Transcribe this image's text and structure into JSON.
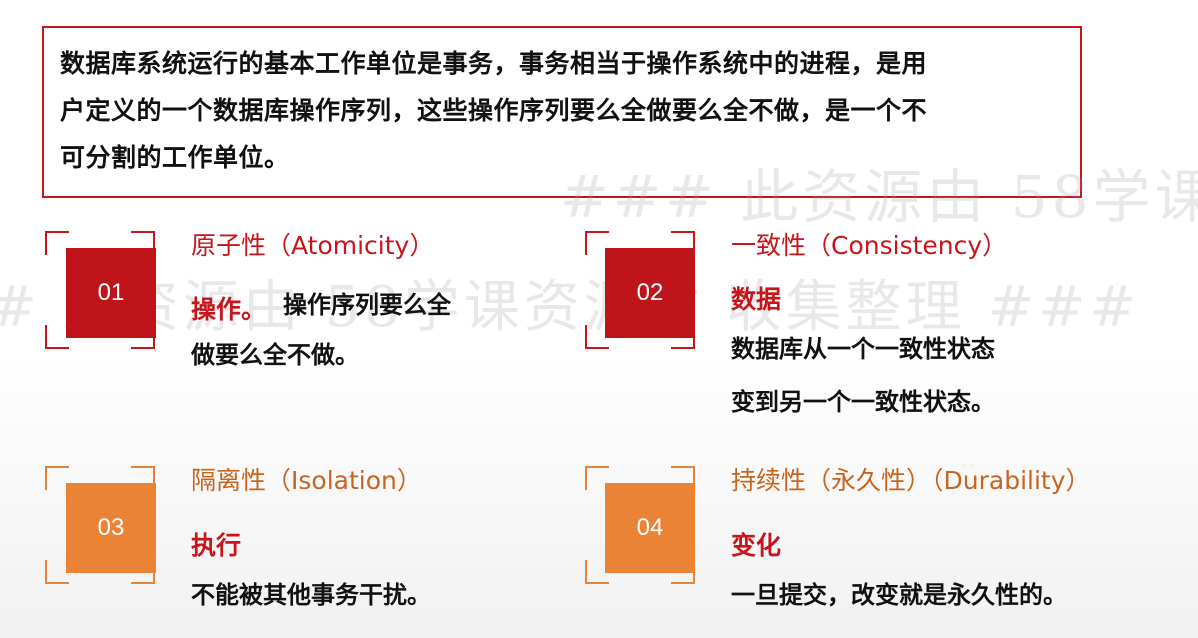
{
  "intro": {
    "line1": "数据库系统运行的基本工作单位是事务，事务相当于操作系统中的进程，是用",
    "line2": "户定义的一个数据库操作序列，这些操作序列要么全做要么全不做，是一个不",
    "line3": "可分割的工作单位。"
  },
  "watermark": {
    "line1": "### 此资源由 58学课",
    "line2": "# 此资源由 58学课资源站 收集整理 ###"
  },
  "items": [
    {
      "num": "01",
      "title": "原子性（Atomicity）",
      "keyword": "操作。",
      "desc1": "操作序列要么全",
      "desc2": "做要么全不做。"
    },
    {
      "num": "02",
      "title": "一致性（Consistency）",
      "keyword": "数据",
      "desc1": "数据库从一个一致性状态",
      "desc2": "变到另一个一致性状态。"
    },
    {
      "num": "03",
      "title": "隔离性（Isolation）",
      "keyword": "执行",
      "desc1": "不能被其他事务干扰。"
    },
    {
      "num": "04",
      "title": "持续性（永久性）（Durability）",
      "keyword": "变化",
      "desc1": "一旦提交，改变就是永久性的。"
    }
  ],
  "colors": {
    "red": "#c8141b",
    "orange": "#ea8335"
  }
}
